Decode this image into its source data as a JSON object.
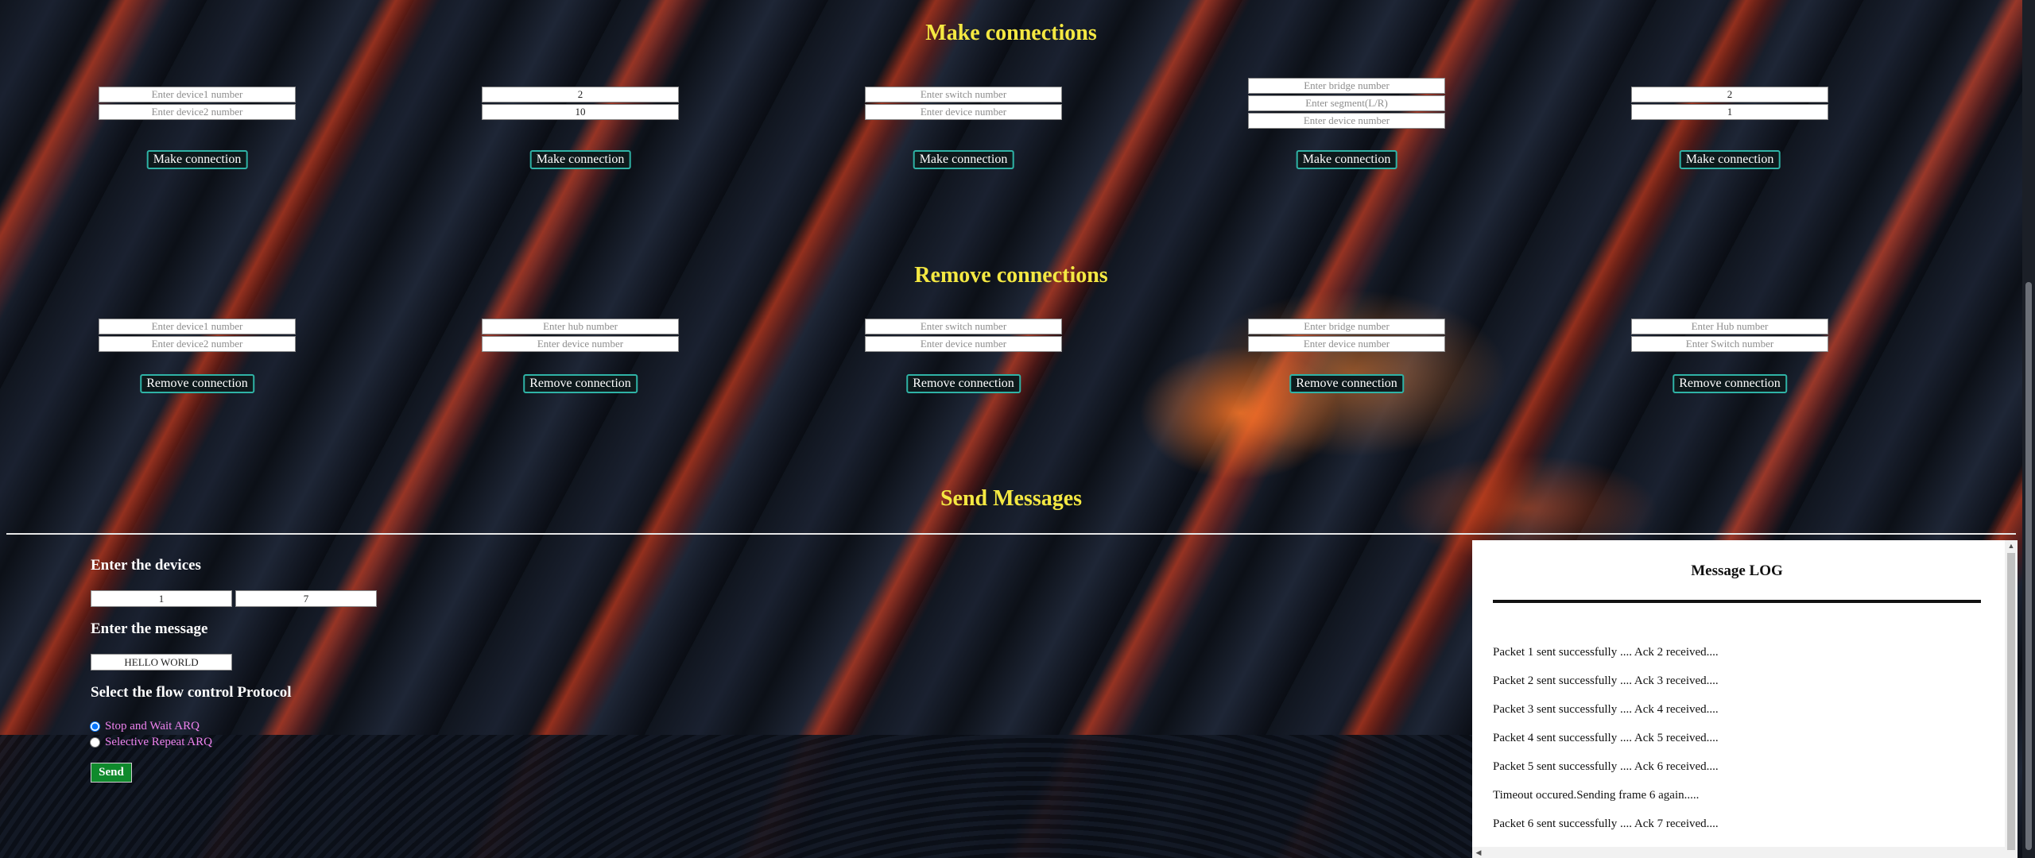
{
  "sections": {
    "make_title": "Make connections",
    "remove_title": "Remove connections",
    "send_title": "Send Messages"
  },
  "make": {
    "button_label": "Make connection",
    "groups": [
      {
        "fields": [
          {
            "placeholder": "Enter device1 number",
            "value": ""
          },
          {
            "placeholder": "Enter device2 number",
            "value": ""
          }
        ]
      },
      {
        "fields": [
          {
            "placeholder": "",
            "value": "2"
          },
          {
            "placeholder": "",
            "value": "10"
          }
        ]
      },
      {
        "fields": [
          {
            "placeholder": "Enter switch number",
            "value": ""
          },
          {
            "placeholder": "Enter device number",
            "value": ""
          }
        ]
      },
      {
        "fields": [
          {
            "placeholder": "Enter bridge number",
            "value": ""
          },
          {
            "placeholder": "Enter segment(L/R)",
            "value": ""
          },
          {
            "placeholder": "Enter device number",
            "value": ""
          }
        ]
      },
      {
        "fields": [
          {
            "placeholder": "",
            "value": "2"
          },
          {
            "placeholder": "",
            "value": "1"
          }
        ]
      }
    ]
  },
  "remove": {
    "button_label": "Remove connection",
    "groups": [
      {
        "fields": [
          {
            "placeholder": "Enter device1 number",
            "value": ""
          },
          {
            "placeholder": "Enter device2 number",
            "value": ""
          }
        ]
      },
      {
        "fields": [
          {
            "placeholder": "Enter hub number",
            "value": ""
          },
          {
            "placeholder": "Enter device number",
            "value": ""
          }
        ]
      },
      {
        "fields": [
          {
            "placeholder": "Enter switch number",
            "value": ""
          },
          {
            "placeholder": "Enter device number",
            "value": ""
          }
        ]
      },
      {
        "fields": [
          {
            "placeholder": "Enter bridge number",
            "value": ""
          },
          {
            "placeholder": "Enter device number",
            "value": ""
          }
        ]
      },
      {
        "fields": [
          {
            "placeholder": "Enter Hub number",
            "value": ""
          },
          {
            "placeholder": "Enter Switch number",
            "value": ""
          }
        ]
      }
    ]
  },
  "send": {
    "devices_label": "Enter the devices",
    "device_from": "1",
    "device_to": "7",
    "message_label": "Enter the message",
    "message": "HELLO WORLD",
    "protocol_label": "Select the flow control Protocol",
    "protocols": [
      {
        "label": "Stop and Wait ARQ",
        "checked": true
      },
      {
        "label": "Selective Repeat ARQ",
        "checked": false
      }
    ],
    "send_label": "Send"
  },
  "log": {
    "title": "Message LOG",
    "entries": [
      "Packet 1 sent successfully .... Ack 2 received....",
      "Packet 2 sent successfully .... Ack 3 received....",
      "Packet 3 sent successfully .... Ack 4 received....",
      "Packet 4 sent successfully .... Ack 5 received....",
      "Packet 5 sent successfully .... Ack 6 received....",
      "Timeout occured.Sending frame 6 again.....",
      "Packet 6 sent successfully .... Ack 7 received...."
    ]
  },
  "colors": {
    "heading": "#f4e842",
    "button_border": "#2fb3a6",
    "send_button": "#0f8a2c",
    "radio_label": "#ee82ee"
  }
}
